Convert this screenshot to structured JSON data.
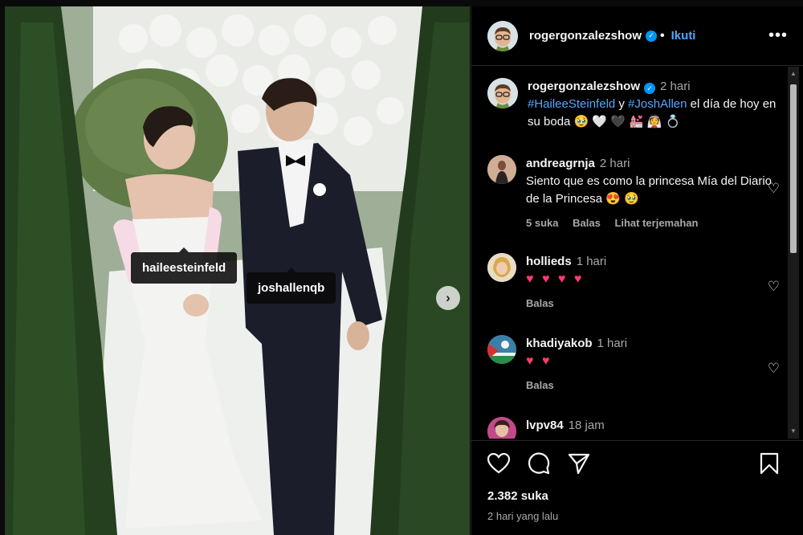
{
  "photo": {
    "tags": [
      "haileesteinfeld",
      "joshallenqb"
    ],
    "next_icon": "chevron-right-icon"
  },
  "header": {
    "username": "rogergonzalezshow",
    "verified": true,
    "follow_label": "Ikuti",
    "more_icon": "more-horizontal-icon"
  },
  "caption": {
    "username": "rogergonzalezshow",
    "time": "2 hari",
    "tag1": "#HaileeSteinfeld",
    "conj": " y ",
    "tag2": "#JoshAllen",
    "text_line": " el día de hoy en su boda 🥹 🤍 🖤 💒 👰 💍"
  },
  "comments": [
    {
      "username": "andreagrnja",
      "time": "2 hari",
      "text": "Siento que es como la princesa Mía del Diario de la Princesa 😍 🥹",
      "likes": "5 suka",
      "reply": "Balas",
      "translate": "Lihat terjemahan"
    },
    {
      "username": "hollieds",
      "time": "1 hari",
      "text": "♥ ♥ ♥ ♥",
      "reply": "Balas"
    },
    {
      "username": "khadiyakob",
      "time": "1 hari",
      "text": "♥ ♥",
      "reply": "Balas"
    },
    {
      "username": "lvpv84",
      "time": "18 jam"
    }
  ],
  "actions": {
    "like_icon": "heart-icon",
    "comment_icon": "comment-icon",
    "share_icon": "share-icon",
    "save_icon": "bookmark-icon",
    "likes": "2.382 suka",
    "posted": "2 hari yang lalu"
  },
  "colors": {
    "link": "#58a6ff",
    "follow": "#4aa8ff",
    "verified": "#0095f6",
    "heart": "#ff3b6b"
  }
}
